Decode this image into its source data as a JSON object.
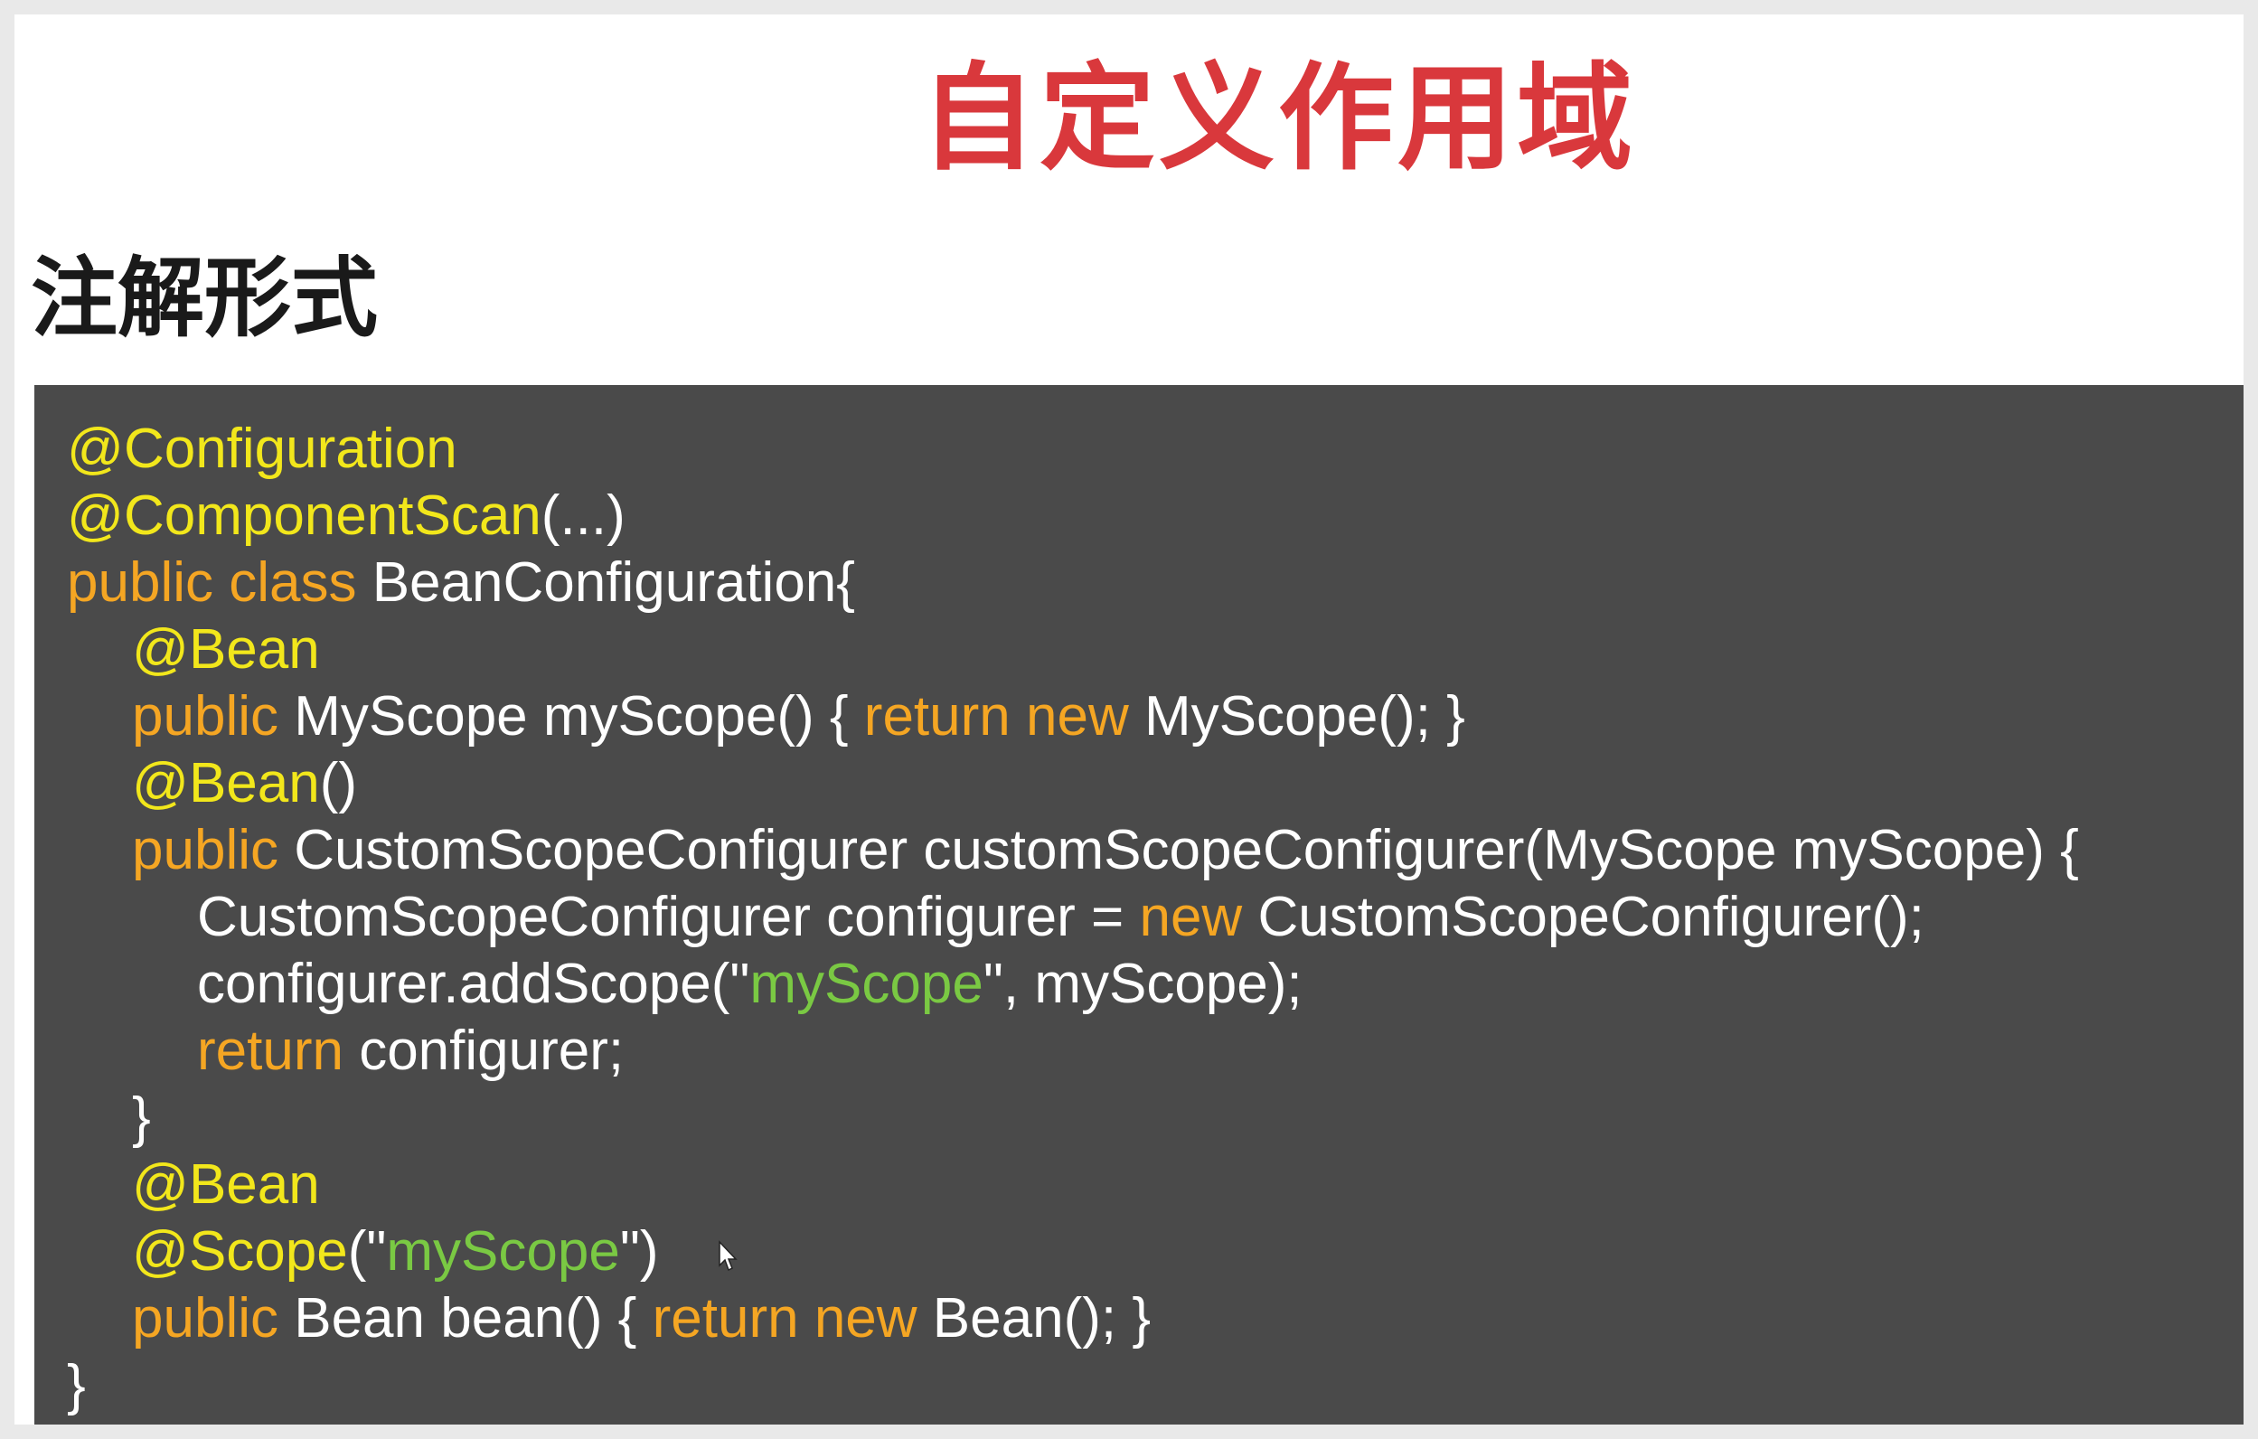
{
  "slide": {
    "title": "自定义作用域",
    "subtitle": "注解形式"
  },
  "code": {
    "lines": [
      {
        "indent": 0,
        "tokens": [
          {
            "type": "annotation",
            "text": "@Configuration"
          }
        ]
      },
      {
        "indent": 0,
        "tokens": [
          {
            "type": "annotation",
            "text": "@ComponentScan"
          },
          {
            "type": "plain",
            "text": "(...)"
          }
        ]
      },
      {
        "indent": 0,
        "tokens": [
          {
            "type": "keyword",
            "text": "public class "
          },
          {
            "type": "plain",
            "text": "BeanConfiguration{"
          }
        ]
      },
      {
        "indent": 1,
        "tokens": [
          {
            "type": "annotation",
            "text": "@Bean"
          }
        ]
      },
      {
        "indent": 1,
        "tokens": [
          {
            "type": "keyword",
            "text": "public "
          },
          {
            "type": "plain",
            "text": "MyScope myScope() { "
          },
          {
            "type": "keyword",
            "text": "return new "
          },
          {
            "type": "plain",
            "text": "MyScope(); }"
          }
        ]
      },
      {
        "indent": 1,
        "tokens": [
          {
            "type": "annotation",
            "text": "@Bean"
          },
          {
            "type": "plain",
            "text": "()"
          }
        ]
      },
      {
        "indent": 1,
        "tokens": [
          {
            "type": "keyword",
            "text": "public "
          },
          {
            "type": "plain",
            "text": "CustomScopeConfigurer customScopeConfigurer(MyScope myScope) {"
          }
        ]
      },
      {
        "indent": 2,
        "tokens": [
          {
            "type": "plain",
            "text": "CustomScopeConfigurer configurer = "
          },
          {
            "type": "keyword",
            "text": "new "
          },
          {
            "type": "plain",
            "text": "CustomScopeConfigurer();"
          }
        ]
      },
      {
        "indent": 2,
        "tokens": [
          {
            "type": "plain",
            "text": "configurer.addScope(\""
          },
          {
            "type": "string",
            "text": "myScope"
          },
          {
            "type": "plain",
            "text": "\", myScope);"
          }
        ]
      },
      {
        "indent": 2,
        "tokens": [
          {
            "type": "keyword",
            "text": "return "
          },
          {
            "type": "plain",
            "text": "configurer;"
          }
        ]
      },
      {
        "indent": 1,
        "tokens": [
          {
            "type": "plain",
            "text": "}"
          }
        ]
      },
      {
        "indent": 1,
        "tokens": [
          {
            "type": "annotation",
            "text": "@Bean"
          }
        ]
      },
      {
        "indent": 1,
        "tokens": [
          {
            "type": "annotation",
            "text": "@Scope"
          },
          {
            "type": "plain",
            "text": "(\""
          },
          {
            "type": "string",
            "text": "myScope"
          },
          {
            "type": "plain",
            "text": "\")"
          }
        ]
      },
      {
        "indent": 1,
        "tokens": [
          {
            "type": "keyword",
            "text": "public "
          },
          {
            "type": "plain",
            "text": "Bean bean() { "
          },
          {
            "type": "keyword",
            "text": "return new "
          },
          {
            "type": "plain",
            "text": "Bean(); }"
          }
        ]
      },
      {
        "indent": 0,
        "tokens": [
          {
            "type": "plain",
            "text": "}"
          }
        ]
      }
    ]
  },
  "colors": {
    "title": "#d9383c",
    "panel_background": "#4a4a4a",
    "annotation": "#f2e71b",
    "keyword": "#f5a623",
    "string": "#7ac943",
    "plain": "#ffffff"
  },
  "icons": {
    "cursor": "mouse-pointer-icon"
  }
}
